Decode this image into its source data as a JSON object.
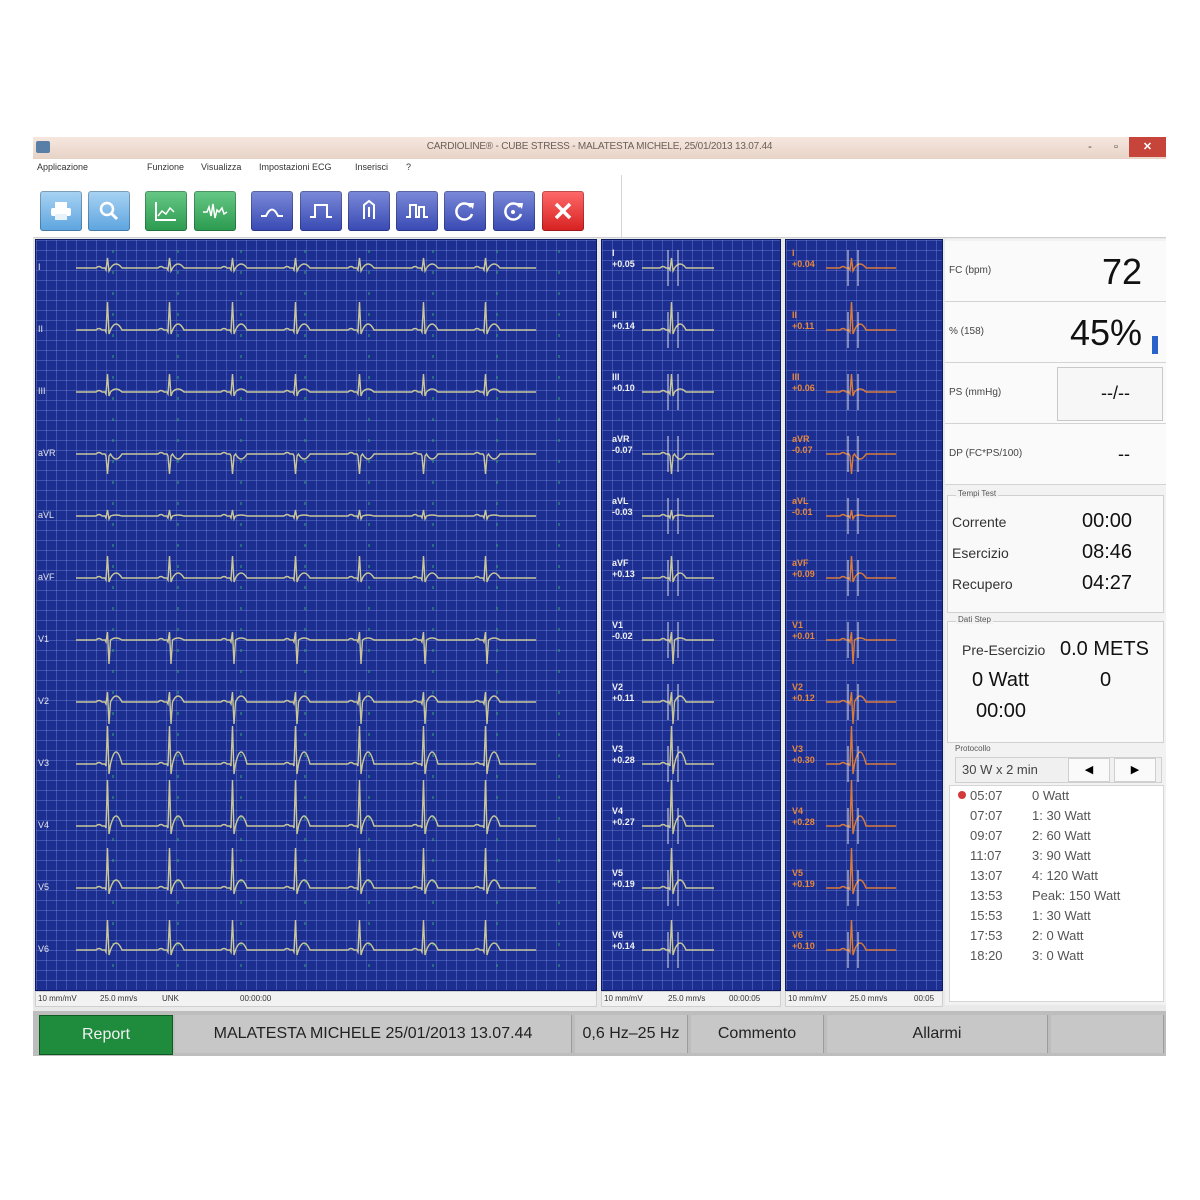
{
  "window": {
    "title": "CARDIOLINE® - CUBE STRESS - MALATESTA MICHELE, 25/01/2013 13.07.44",
    "minimize": "-",
    "maximize": "▫",
    "close": "✕"
  },
  "menu": [
    "Applicazione",
    "Funzione",
    "Visualizza",
    "Impostazioni ECG",
    "Inserisci",
    "?"
  ],
  "toolbar": {
    "buttons": [
      "printer-icon",
      "zoom-icon",
      "trend-icon",
      "ecg-wave-icon",
      "pulse-1-icon",
      "pulse-2-icon",
      "pulse-3-icon",
      "pulse-4-icon",
      "rotate-icon",
      "timer-icon",
      "close-icon"
    ]
  },
  "leads": [
    "I",
    "II",
    "III",
    "aVR",
    "aVL",
    "aVF",
    "V1",
    "V2",
    "V3",
    "V4",
    "V5",
    "V6"
  ],
  "mid_panel": {
    "values": [
      "+0.05",
      "+0.14",
      "+0.10",
      "-0.07",
      "-0.03",
      "+0.13",
      "-0.02",
      "+0.11",
      "+0.28",
      "+0.27",
      "+0.19",
      "+0.14"
    ]
  },
  "right_panel": {
    "values": [
      "+0.04",
      "+0.11",
      "+0.06",
      "-0.07",
      "-0.01",
      "+0.09",
      "+0.01",
      "+0.12",
      "+0.30",
      "+0.28",
      "+0.19",
      "+0.10"
    ]
  },
  "status": {
    "main": [
      "10 mm/mV",
      "25.0 mm/s",
      "UNK",
      "00:00:00"
    ],
    "mid": [
      "10 mm/mV",
      "25.0 mm/s",
      "00:00:05"
    ],
    "right": [
      "10 mm/mV",
      "25.0 mm/s",
      "00:05"
    ]
  },
  "vitals": {
    "fc_label": "FC (bpm)",
    "fc_value": "72",
    "pct_label": "% (158)",
    "pct_value": "45%",
    "ps_label": "PS (mmHg)",
    "ps_value": "--/--",
    "dp_label": "DP (FC*PS/100)",
    "dp_value": "--"
  },
  "tempi": {
    "title": "Tempi Test",
    "corrente_label": "Corrente",
    "corrente_value": "00:00",
    "esercizio_label": "Esercizio",
    "esercizio_value": "08:46",
    "recupero_label": "Recupero",
    "recupero_value": "04:27"
  },
  "dati_step": {
    "title": "Dati Step",
    "phase": "Pre-Esercizio",
    "mets": "0.0 METS",
    "watt": "0 Watt",
    "count": "0",
    "time": "00:00"
  },
  "protocollo": {
    "title": "Protocollo",
    "selected": "30 W x 2 min",
    "prev": "◀",
    "next": "▶",
    "rows": [
      {
        "time": "05:07",
        "desc": "0 Watt"
      },
      {
        "time": "07:07",
        "desc": "1: 30 Watt"
      },
      {
        "time": "09:07",
        "desc": "2: 60 Watt"
      },
      {
        "time": "11:07",
        "desc": "3: 90 Watt"
      },
      {
        "time": "13:07",
        "desc": "4: 120 Watt"
      },
      {
        "time": "13:53",
        "desc": "Peak: 150 Watt"
      },
      {
        "time": "15:53",
        "desc": "1: 30 Watt"
      },
      {
        "time": "17:53",
        "desc": "2: 0 Watt"
      },
      {
        "time": "18:20",
        "desc": "3: 0 Watt"
      }
    ]
  },
  "bottom": {
    "report": "Report",
    "patient": "MALATESTA MICHELE   25/01/2013 13.07.44",
    "filter": "0,6 Hz–25 Hz",
    "commento": "Commento",
    "allarmi": "Allarmi"
  }
}
